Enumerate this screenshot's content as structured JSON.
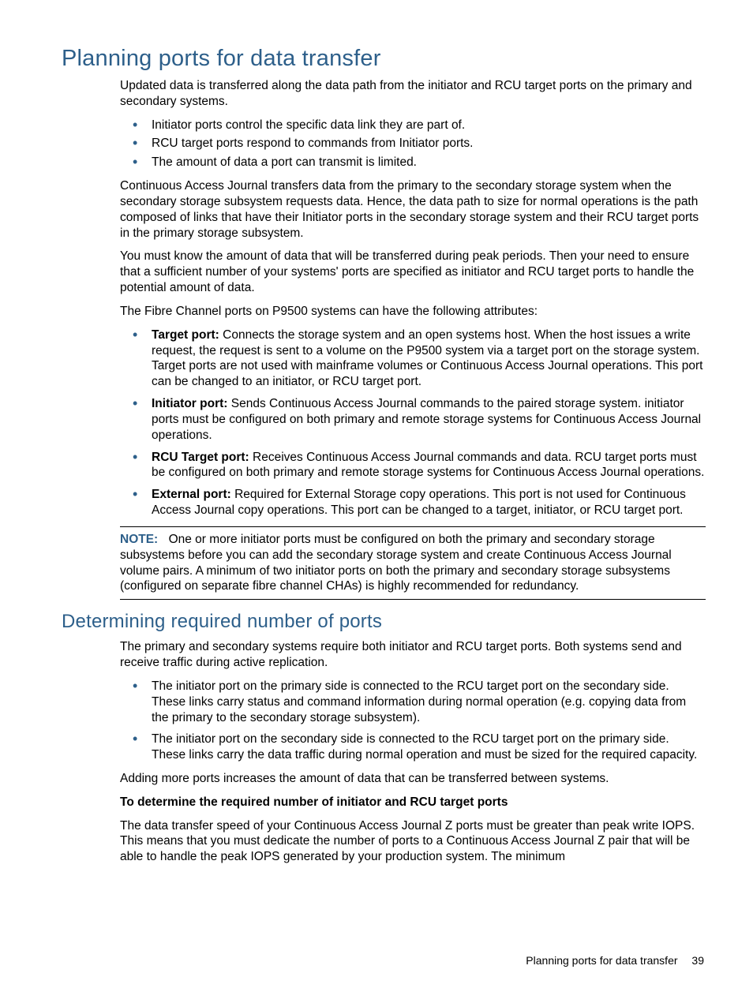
{
  "h1": "Planning ports for data transfer",
  "p1": "Updated data is transferred along the data path from the initiator and RCU target ports on the primary and secondary systems.",
  "list1": [
    "Initiator ports control the specific data link they are part of.",
    "RCU target ports respond to commands from Initiator ports.",
    "The amount of data a port can transmit is limited."
  ],
  "p2": "Continuous Access Journal transfers data from the primary to the secondary storage system when the secondary storage subsystem requests data. Hence, the data path to size for normal operations is the path composed of links that have their Initiator ports in the secondary storage system and their RCU target ports in the primary storage subsystem.",
  "p3": "You must know the amount of data that will be transferred during peak periods. Then your need to ensure that a sufficient number of your systems' ports are specified as initiator and RCU target ports to handle the potential amount of data.",
  "p4": "The Fibre Channel ports on P9500 systems can have the following attributes:",
  "ports": [
    {
      "term": "Target port:",
      "text": " Connects the storage system and an open systems host. When the host issues a write request, the request is sent to a volume on the P9500 system via a target port on the storage system. Target ports are not used with mainframe volumes or Continuous Access Journal operations. This port can be changed to an initiator, or RCU target port."
    },
    {
      "term": "Initiator port:",
      "text": " Sends Continuous Access Journal commands to the paired storage system. initiator ports must be configured on both primary and remote storage systems for Continuous Access Journal operations."
    },
    {
      "term": "RCU Target port:",
      "text": " Receives Continuous Access Journal commands and data. RCU target ports must be configured on both primary and remote storage systems for Continuous Access Journal operations."
    },
    {
      "term": "External port:",
      "text": " Required for External Storage copy operations. This port is not used for Continuous Access Journal copy operations. This port can be changed to a target, initiator, or RCU target port."
    }
  ],
  "note": {
    "label": "NOTE:",
    "text": "One or more initiator ports must be configured on both the primary and secondary storage subsystems before you can add the secondary storage system and create Continuous Access Journal volume pairs. A minimum of two initiator ports on both the primary and secondary storage subsystems (configured on separate fibre channel CHAs) is highly recommended for redundancy."
  },
  "h2": "Determining required number of ports",
  "p5": "The primary and secondary systems require both initiator and RCU target ports. Both systems send and receive traffic during active replication.",
  "list2": [
    "The initiator port on the primary side is connected to the RCU target port on the secondary side. These links carry status and command information during normal operation (e.g. copying data from the primary to the secondary storage subsystem).",
    "The initiator port on the secondary side is connected to the RCU target port on the primary side. These links carry the data traffic during normal operation and must be sized for the required capacity."
  ],
  "p6": "Adding more ports increases the amount of data that can be transferred between systems.",
  "p7_bold": "To determine the required number of initiator and RCU target ports",
  "p8": "The data transfer speed of your Continuous Access Journal Z ports must be greater than peak write IOPS. This means that you must dedicate the number of ports to a Continuous Access Journal Z pair that will be able to handle the peak IOPS generated by your production system. The minimum",
  "footer": {
    "section": "Planning ports for data transfer",
    "page": "39"
  }
}
